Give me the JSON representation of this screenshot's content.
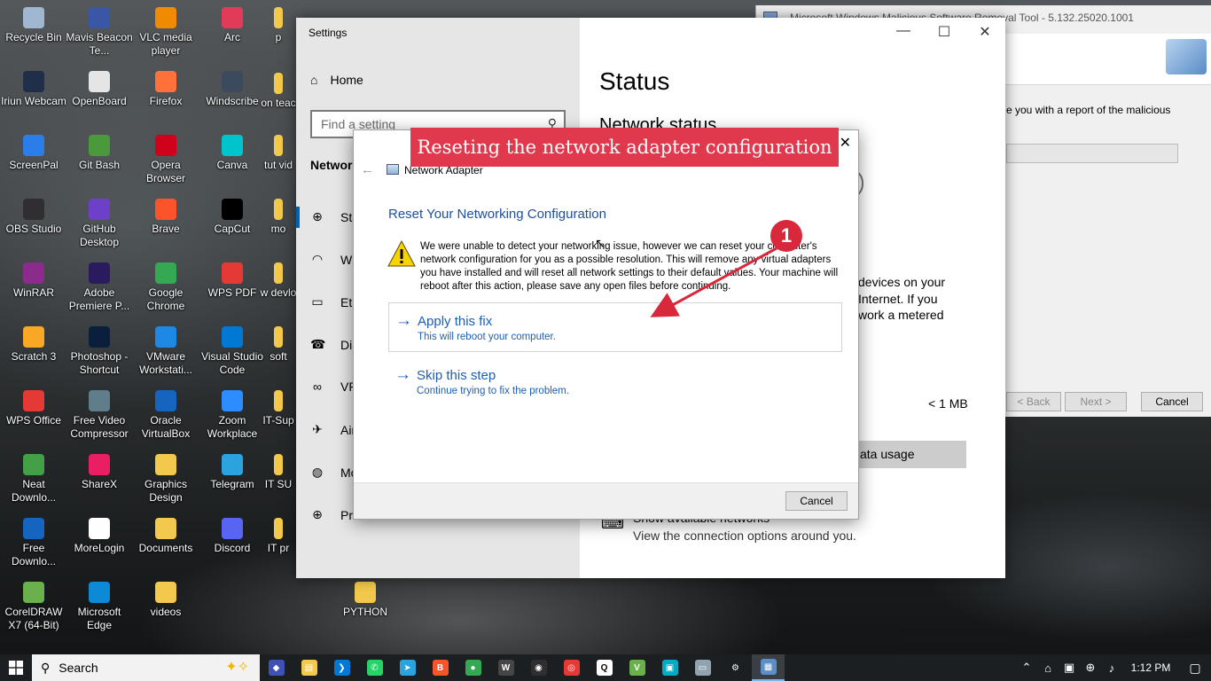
{
  "desktop": {
    "icons": [
      {
        "label": "Recycle Bin",
        "icon": "recycle-bin-icon",
        "color": "#9fb7d0"
      },
      {
        "label": "Mavis Beacon Te...",
        "icon": "mavis-beacon-icon",
        "color": "#3a56a6"
      },
      {
        "label": "VLC media player",
        "icon": "vlc-icon",
        "color": "#f08a00"
      },
      {
        "label": "Arc",
        "icon": "arc-icon",
        "color": "#e23b5a"
      },
      {
        "label": "Iriun Webcam",
        "icon": "iriun-webcam-icon",
        "color": "#1f2f4a"
      },
      {
        "label": "OpenBoard",
        "icon": "openboard-icon",
        "color": "#e5e5e5"
      },
      {
        "label": "Firefox",
        "icon": "firefox-icon",
        "color": "#ff7139"
      },
      {
        "label": "Windscribe",
        "icon": "windscribe-icon",
        "color": "#3b4a5c"
      },
      {
        "label": "ScreenPal",
        "icon": "screenpal-icon",
        "color": "#2b7de9"
      },
      {
        "label": "Git Bash",
        "icon": "git-bash-icon",
        "color": "#4a9a3b"
      },
      {
        "label": "Opera Browser",
        "icon": "opera-icon",
        "color": "#d0021b"
      },
      {
        "label": "Canva",
        "icon": "canva-icon",
        "color": "#00c4cc"
      },
      {
        "label": "OBS Studio",
        "icon": "obs-icon",
        "color": "#302e31"
      },
      {
        "label": "GitHub Desktop",
        "icon": "github-desktop-icon",
        "color": "#6e40c9"
      },
      {
        "label": "Brave",
        "icon": "brave-icon",
        "color": "#fb542b"
      },
      {
        "label": "CapCut",
        "icon": "capcut-icon",
        "color": "#000000"
      },
      {
        "label": "WinRAR",
        "icon": "winrar-icon",
        "color": "#8b2b8b"
      },
      {
        "label": "Adobe Premiere P...",
        "icon": "premiere-icon",
        "color": "#2a1a5e"
      },
      {
        "label": "Google Chrome",
        "icon": "chrome-icon",
        "color": "#34a853"
      },
      {
        "label": "WPS PDF",
        "icon": "wps-pdf-icon",
        "color": "#e53935"
      },
      {
        "label": "Scratch 3",
        "icon": "scratch-icon",
        "color": "#f9a825"
      },
      {
        "label": "Photoshop - Shortcut",
        "icon": "photoshop-icon",
        "color": "#0a1f3c"
      },
      {
        "label": "VMware Workstati...",
        "icon": "vmware-icon",
        "color": "#1e88e5"
      },
      {
        "label": "Visual Studio Code",
        "icon": "vscode-icon",
        "color": "#0078d4"
      },
      {
        "label": "WPS Office",
        "icon": "wps-office-icon",
        "color": "#e53935"
      },
      {
        "label": "Free Video Compressor",
        "icon": "video-compressor-icon",
        "color": "#607d8b"
      },
      {
        "label": "Oracle VirtualBox",
        "icon": "virtualbox-icon",
        "color": "#1565c0"
      },
      {
        "label": "Zoom Workplace",
        "icon": "zoom-icon",
        "color": "#2d8cff"
      },
      {
        "label": "Neat Downlo...",
        "icon": "neat-download-icon",
        "color": "#43a047"
      },
      {
        "label": "ShareX",
        "icon": "sharex-icon",
        "color": "#e91e63"
      },
      {
        "label": "Graphics Design",
        "icon": "folder-icon",
        "color": "#f2c94c"
      },
      {
        "label": "Telegram",
        "icon": "telegram-icon",
        "color": "#2aa3df"
      },
      {
        "label": "Free Downlo...",
        "icon": "free-download-icon",
        "color": "#1565c0"
      },
      {
        "label": "MoreLogin",
        "icon": "morelogin-icon",
        "color": "#ffffff"
      },
      {
        "label": "Documents",
        "icon": "documents-icon",
        "color": "#f2c94c"
      },
      {
        "label": "Discord",
        "icon": "discord-icon",
        "color": "#5865f2"
      },
      {
        "label": "CorelDRAW X7 (64-Bit)",
        "icon": "coreldraw-icon",
        "color": "#6ab04c"
      },
      {
        "label": "Microsoft Edge",
        "icon": "edge-icon",
        "color": "#0c8ad6"
      },
      {
        "label": "videos",
        "icon": "folder-icon",
        "color": "#f2c94c"
      },
      {
        "label": "PYTHON",
        "icon": "folder-icon",
        "color": "#f2c94c"
      }
    ],
    "partial_labels": [
      "p",
      "on teac",
      "tut vid",
      "mo",
      "w devlo",
      "soft",
      "IT-Sup",
      "IT SU",
      "IT pr"
    ]
  },
  "settings": {
    "title": "Settings",
    "home": "Home",
    "search_placeholder": "Find a setting",
    "section": "Network",
    "nav": [
      {
        "label": "Status",
        "icon": "globe-icon"
      },
      {
        "label": "Wi-Fi",
        "icon": "wifi-icon"
      },
      {
        "label": "Ethernet",
        "icon": "ethernet-icon"
      },
      {
        "label": "Dial-up",
        "icon": "dialup-icon"
      },
      {
        "label": "VPN",
        "icon": "vpn-icon"
      },
      {
        "label": "Airplane mode",
        "icon": "airplane-icon"
      },
      {
        "label": "Mobile hotspot",
        "icon": "hotspot-icon"
      },
      {
        "label": "Proxy",
        "icon": "globe-icon"
      }
    ],
    "nav_visible": [
      "Sta",
      "Wi",
      "Eth",
      "Dia",
      "VP",
      "Air",
      "Mo",
      "Pro"
    ],
    "main_title": "Status",
    "network_status": "Network status",
    "right_lines": [
      "devices on your",
      "Internet. If you",
      "work a metered"
    ],
    "data_size": "< 1 MB",
    "data_usage_btn": "ata usage",
    "show_networks": "Show available networks",
    "show_networks_sub": "View the connection options around you."
  },
  "msrt": {
    "title": "Microsoft Windows Malicious Software Removal Tool - 5.132.25020.1001",
    "body_text": "e you with a report of the malicious",
    "buttons": {
      "back": "< Back",
      "next": "Next >",
      "cancel": "Cancel"
    }
  },
  "dialog": {
    "title": "Network Adapter",
    "heading": "Reset Your Networking Configuration",
    "message": "We were unable to detect your networking issue, however we can reset your computer's network configuration for you as a possible resolution. This will remove any virtual adapters you have installed and will reset all network settings to their default values. Your machine will reboot after this action, please save any open files before continuing.",
    "options": [
      {
        "title": "Apply this fix",
        "sub": "This will reboot your computer."
      },
      {
        "title": "Skip this step",
        "sub": "Continue trying to fix the problem."
      }
    ],
    "cancel": "Cancel"
  },
  "annotation": {
    "banner": "Reseting the network adapter configuration",
    "step": "1",
    "color": "#e0394e"
  },
  "taskbar": {
    "search": "Search",
    "apps": [
      {
        "icon": "app-1-icon",
        "color": "#3f51b5",
        "glyph": "◆"
      },
      {
        "icon": "file-explorer-icon",
        "color": "#f2c94c",
        "glyph": "▤"
      },
      {
        "icon": "vscode-icon",
        "color": "#0078d4",
        "glyph": "❯"
      },
      {
        "icon": "whatsapp-icon",
        "color": "#25d366",
        "glyph": "✆"
      },
      {
        "icon": "telegram-icon",
        "color": "#2aa3df",
        "glyph": "➤"
      },
      {
        "icon": "brave-icon",
        "color": "#fb542b",
        "glyph": "B"
      },
      {
        "icon": "chrome-icon",
        "color": "#34a853",
        "glyph": "●"
      },
      {
        "icon": "wordpress-icon",
        "color": "#464646",
        "glyph": "W"
      },
      {
        "icon": "obs-icon",
        "color": "#302e31",
        "glyph": "◉"
      },
      {
        "icon": "app-color-icon",
        "color": "#e53935",
        "glyph": "◎"
      },
      {
        "icon": "app-q-icon",
        "color": "#ffffff",
        "glyph": "Q"
      },
      {
        "icon": "vscode-alt-icon",
        "color": "#6ab04c",
        "glyph": "V"
      },
      {
        "icon": "app-teal-icon",
        "color": "#00acc1",
        "glyph": "▣"
      },
      {
        "icon": "app-window-icon",
        "color": "#90a4ae",
        "glyph": "▭"
      },
      {
        "icon": "settings-icon",
        "color": "#1c1f22",
        "glyph": "⚙"
      },
      {
        "icon": "network-adapter-icon",
        "color": "#5c8ec7",
        "glyph": "▦"
      }
    ],
    "tray": {
      "time": "1:12 PM"
    }
  }
}
